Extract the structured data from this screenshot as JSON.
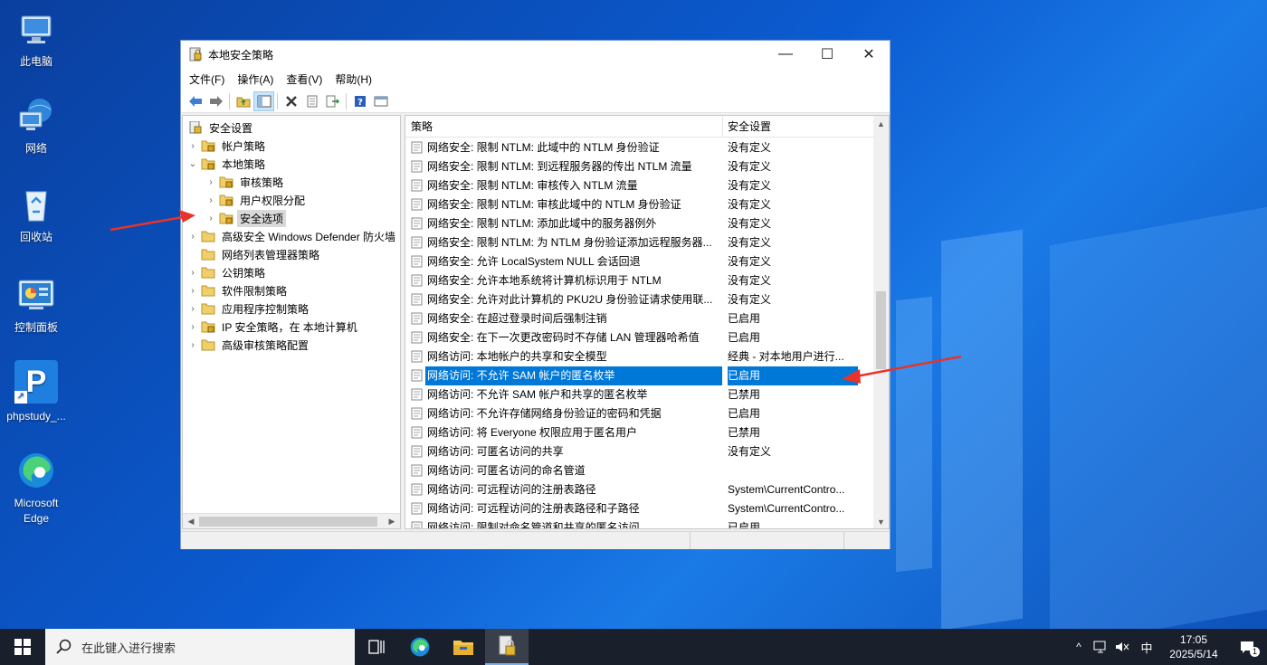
{
  "desktop": {
    "icons": [
      {
        "label": "此电脑",
        "icon": "computer-icon"
      },
      {
        "label": "网络",
        "icon": "network-icon"
      },
      {
        "label": "回收站",
        "icon": "recycle-bin-icon"
      },
      {
        "label": "控制面板",
        "icon": "control-panel-icon"
      },
      {
        "label": "phpstudy_...",
        "icon": "phpstudy-icon",
        "glyph": "P"
      },
      {
        "label": "Microsoft Edge",
        "icon": "edge-icon"
      }
    ]
  },
  "window": {
    "title": "本地安全策略",
    "controls": {
      "minimize": "—",
      "maximize": "☐",
      "close": "✕"
    },
    "menu": [
      "文件(F)",
      "操作(A)",
      "查看(V)",
      "帮助(H)"
    ],
    "toolbar": [
      "back-icon",
      "forward-icon",
      "up-folder-icon",
      "show-hide-tree-icon",
      "delete-icon",
      "properties-icon",
      "export-icon",
      "help-icon",
      "console-icon"
    ]
  },
  "tree": {
    "root": "安全设置",
    "items": [
      {
        "label": "帐户策略",
        "level": 1,
        "expander": "›"
      },
      {
        "label": "本地策略",
        "level": 1,
        "expander": "⌄"
      },
      {
        "label": "审核策略",
        "level": 2,
        "expander": "›"
      },
      {
        "label": "用户权限分配",
        "level": 2,
        "expander": "›"
      },
      {
        "label": "安全选项",
        "level": 2,
        "expander": "›",
        "selected": true
      },
      {
        "label": "高级安全 Windows Defender 防火墙",
        "level": 1,
        "expander": "›"
      },
      {
        "label": "网络列表管理器策略",
        "level": 1,
        "expander": ""
      },
      {
        "label": "公钥策略",
        "level": 1,
        "expander": "›"
      },
      {
        "label": "软件限制策略",
        "level": 1,
        "expander": "›"
      },
      {
        "label": "应用程序控制策略",
        "level": 1,
        "expander": "›"
      },
      {
        "label": "IP 安全策略，在 本地计算机",
        "level": 1,
        "expander": "›"
      },
      {
        "label": "高级审核策略配置",
        "level": 1,
        "expander": "›"
      }
    ]
  },
  "list": {
    "columns": {
      "policy": "策略",
      "setting": "安全设置"
    },
    "rows": [
      {
        "policy": "网络安全: 限制 NTLM: 此域中的 NTLM 身份验证",
        "setting": "没有定义"
      },
      {
        "policy": "网络安全: 限制 NTLM: 到远程服务器的传出 NTLM 流量",
        "setting": "没有定义"
      },
      {
        "policy": "网络安全: 限制 NTLM: 审核传入 NTLM 流量",
        "setting": "没有定义"
      },
      {
        "policy": "网络安全: 限制 NTLM: 审核此域中的 NTLM 身份验证",
        "setting": "没有定义"
      },
      {
        "policy": "网络安全: 限制 NTLM: 添加此域中的服务器例外",
        "setting": "没有定义"
      },
      {
        "policy": "网络安全: 限制 NTLM: 为 NTLM 身份验证添加远程服务器...",
        "setting": "没有定义"
      },
      {
        "policy": "网络安全: 允许 LocalSystem NULL 会话回退",
        "setting": "没有定义"
      },
      {
        "policy": "网络安全: 允许本地系统将计算机标识用于 NTLM",
        "setting": "没有定义"
      },
      {
        "policy": "网络安全: 允许对此计算机的 PKU2U 身份验证请求使用联...",
        "setting": "没有定义"
      },
      {
        "policy": "网络安全: 在超过登录时间后强制注销",
        "setting": "已启用"
      },
      {
        "policy": "网络安全: 在下一次更改密码时不存储 LAN 管理器哈希值",
        "setting": "已启用"
      },
      {
        "policy": "网络访问: 本地帐户的共享和安全模型",
        "setting": "经典 - 对本地用户进行..."
      },
      {
        "policy": "网络访问: 不允许 SAM 帐户的匿名枚举",
        "setting": "已启用",
        "selected": true
      },
      {
        "policy": "网络访问: 不允许 SAM 帐户和共享的匿名枚举",
        "setting": "已禁用"
      },
      {
        "policy": "网络访问: 不允许存储网络身份验证的密码和凭据",
        "setting": "已启用"
      },
      {
        "policy": "网络访问: 将 Everyone 权限应用于匿名用户",
        "setting": "已禁用"
      },
      {
        "policy": "网络访问: 可匿名访问的共享",
        "setting": "没有定义"
      },
      {
        "policy": "网络访问: 可匿名访问的命名管道",
        "setting": ""
      },
      {
        "policy": "网络访问: 可远程访问的注册表路径",
        "setting": "System\\CurrentContro..."
      },
      {
        "policy": "网络访问: 可远程访问的注册表路径和子路径",
        "setting": "System\\CurrentContro..."
      },
      {
        "policy": "网络访问: 限制对命名管道和共享的匿名访问",
        "setting": "已启用"
      }
    ]
  },
  "taskbar": {
    "search_placeholder": "在此键入进行搜索",
    "ime": "中",
    "time": "17:05",
    "date": "2025/5/14",
    "notifications": "1"
  },
  "colors": {
    "selection": "#0078d7",
    "annotation_arrow": "#e8332a"
  }
}
